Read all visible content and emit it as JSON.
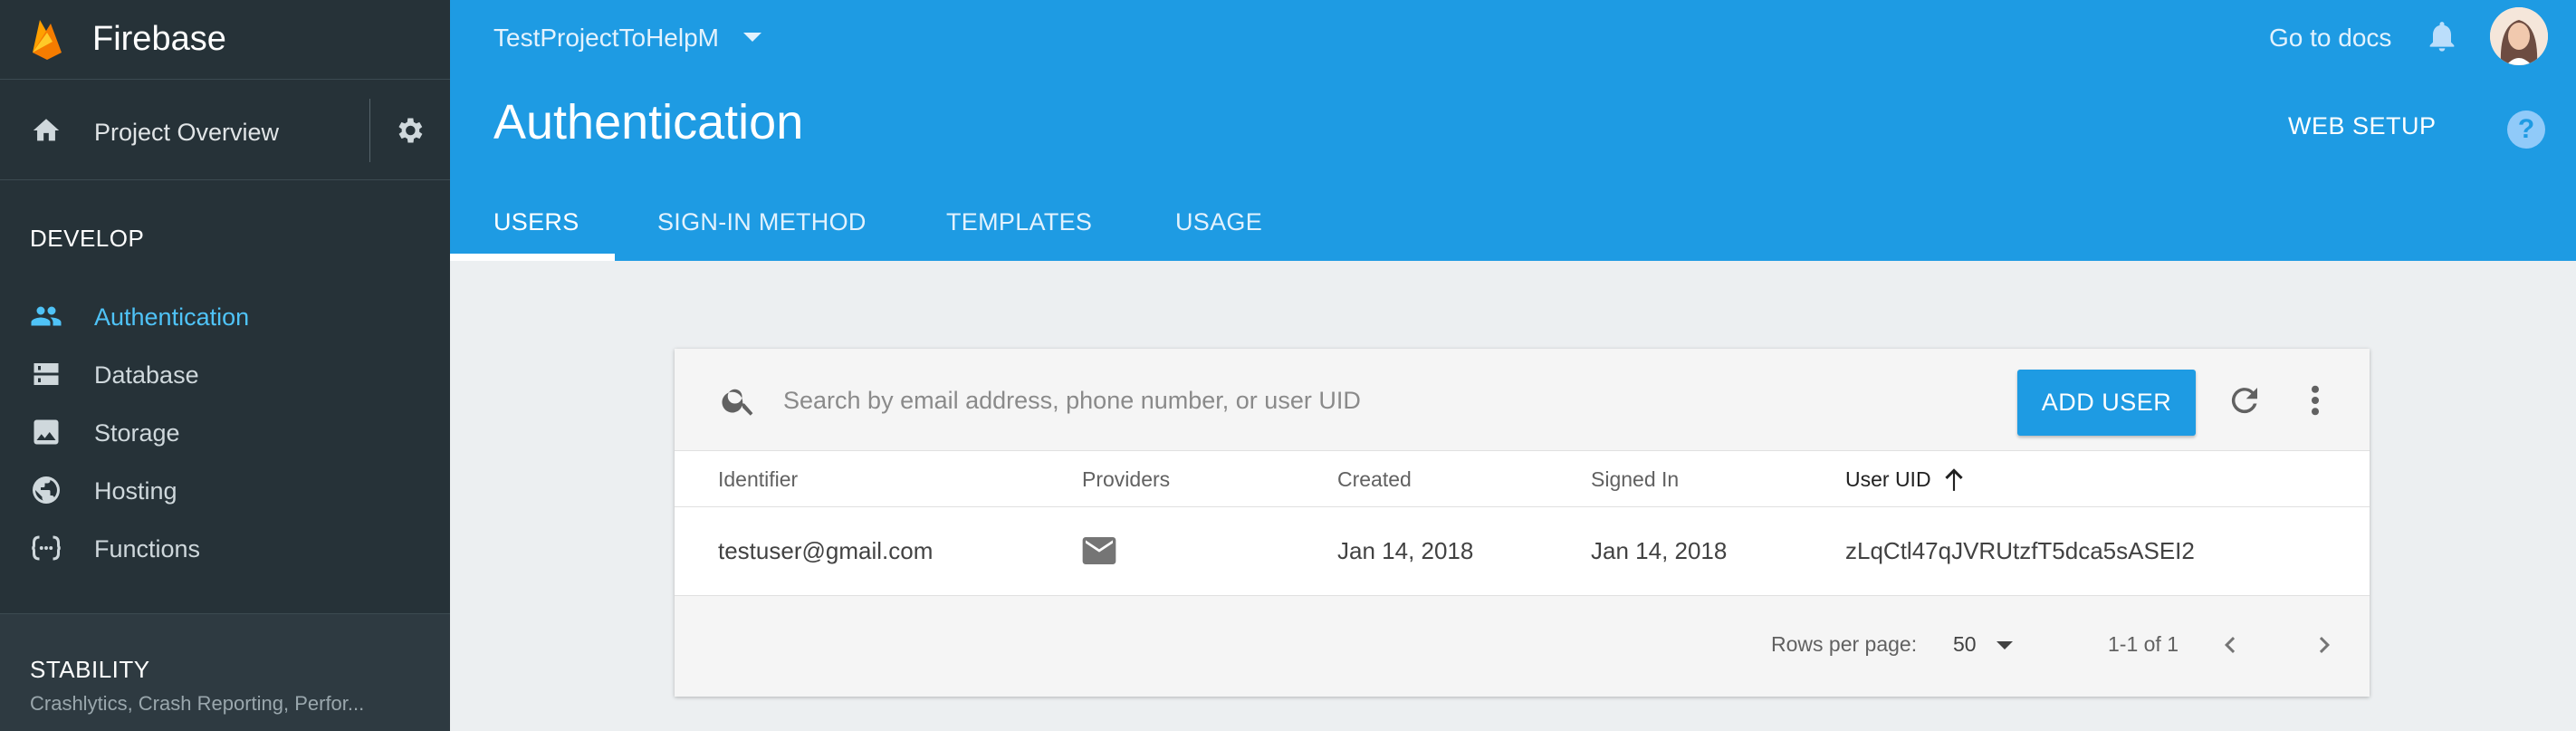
{
  "brand": {
    "name": "Firebase"
  },
  "sidebar": {
    "overview_label": "Project Overview",
    "develop_title": "DEVELOP",
    "items": [
      {
        "label": "Authentication",
        "icon": "people-icon",
        "active": true
      },
      {
        "label": "Database",
        "icon": "database-icon",
        "active": false
      },
      {
        "label": "Storage",
        "icon": "image-icon",
        "active": false
      },
      {
        "label": "Hosting",
        "icon": "globe-icon",
        "active": false
      },
      {
        "label": "Functions",
        "icon": "functions-icon",
        "active": false
      }
    ],
    "stability_title": "STABILITY",
    "stability_subtitle": "Crashlytics, Crash Reporting, Perfor..."
  },
  "header": {
    "project_name": "TestProjectToHelpM",
    "docs_link": "Go to docs",
    "title": "Authentication",
    "web_setup": "WEB SETUP",
    "help": "?",
    "tabs": [
      {
        "label": "USERS",
        "active": true
      },
      {
        "label": "SIGN-IN METHOD",
        "active": false
      },
      {
        "label": "TEMPLATES",
        "active": false
      },
      {
        "label": "USAGE",
        "active": false
      }
    ]
  },
  "users": {
    "search_placeholder": "Search by email address, phone number, or user UID",
    "add_user": "ADD USER",
    "columns": [
      "Identifier",
      "Providers",
      "Created",
      "Signed In",
      "User UID"
    ],
    "sorted_column": "User UID",
    "rows": [
      {
        "identifier": "testuser@gmail.com",
        "provider_icon": "email-icon",
        "created": "Jan 14, 2018",
        "signed_in": "Jan 14, 2018",
        "uid": "zLqCtl47qJVRUtzfT5dca5sASEI2"
      }
    ],
    "rows_per_page_label": "Rows per page:",
    "rows_per_page": "50",
    "range": "1-1 of 1"
  },
  "colors": {
    "header_blue": "#1e9be3",
    "sidebar_dark": "#263238",
    "active_nav": "#4fc3f7"
  }
}
